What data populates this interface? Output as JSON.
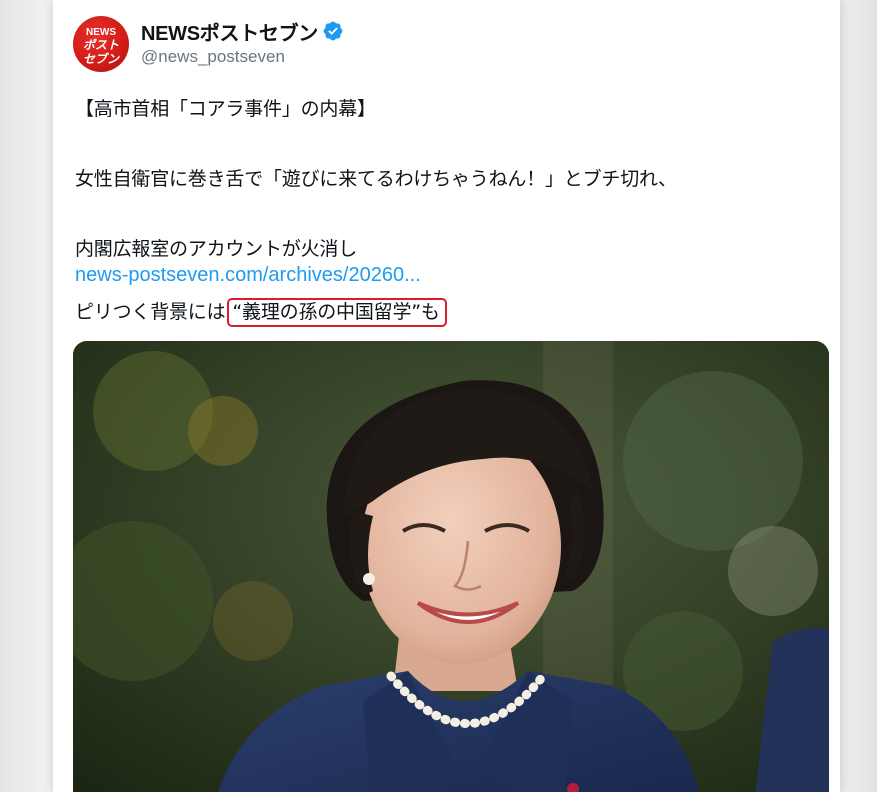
{
  "account": {
    "display_name": "NEWSポストセブン",
    "handle": "@news_postseven",
    "logo_text": "NEWSポストセブン",
    "verified_icon": "verified-badge-icon"
  },
  "tweet": {
    "title": "【高市首相「コアラ事件」の内幕】",
    "line1": "女性自衛官に巻き舌で「遊びに来てるわけちゃうねん！」とブチ切れ、",
    "line2": "内閣広報室のアカウントが火消し",
    "link": "news-postseven.com/archives/20260...",
    "line3_prefix": "ピリつく背景には",
    "line3_highlight": "“義理の孫の中国留学”も"
  },
  "media": {
    "type": "photo",
    "subject": "smiling woman with short dark hair, pearl necklace, navy patterned jacket, green garden background"
  },
  "colors": {
    "link": "#1d9bf0",
    "verified": "#1d9bf0",
    "logo_red": "#cf1b17",
    "highlight_border": "#d61f2b",
    "text": "#0f1419",
    "secondary_text": "#687684"
  }
}
